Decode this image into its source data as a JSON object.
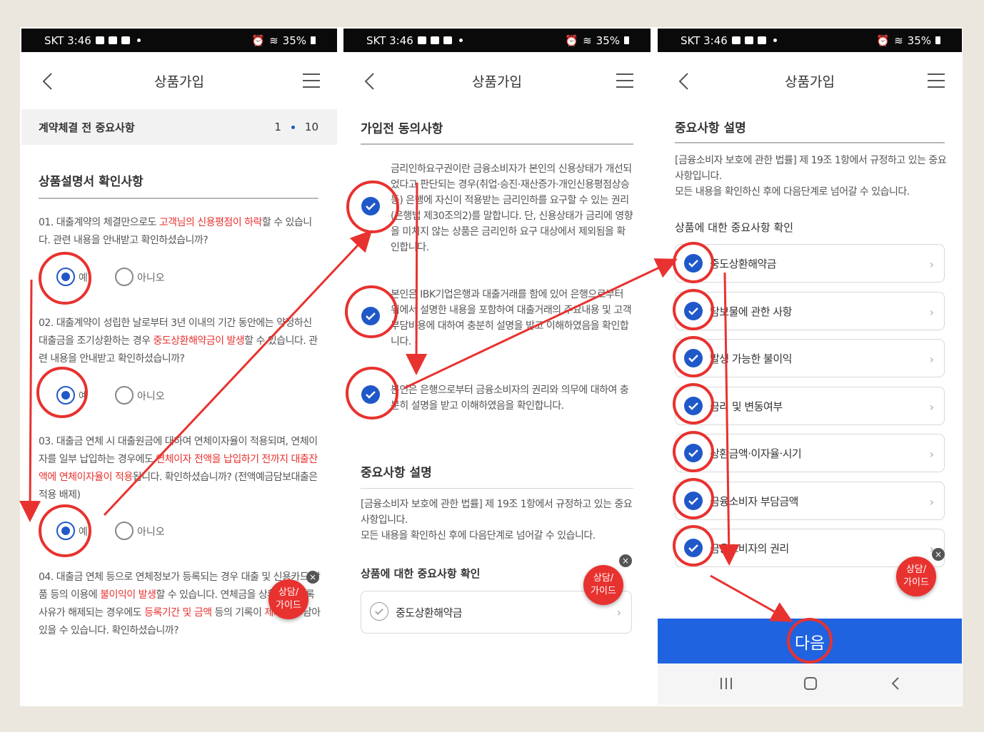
{
  "colors": {
    "accent_blue": "#1f58c8",
    "annotation_red": "#e8322f",
    "next_button": "#1f63e0"
  },
  "statusbar": {
    "carrier_time": "SKT 3:46",
    "battery": "35%"
  },
  "appbar": {
    "title": "상품가입"
  },
  "fab": {
    "line1": "상담/",
    "line2": "가이드",
    "close": "×"
  },
  "screen1": {
    "step_label": "계약체결 전 중요사항",
    "step_current": "1",
    "step_total": "10",
    "section_title": "상품설명서 확인사항",
    "yes": "예",
    "no": "아니오",
    "q1": {
      "a": "01. 대출계약의 체결만으로도 ",
      "red": "고객님의 신용평점이 하락",
      "b": "할 수 있습니다. 관련 내용을 안내받고 확인하셨습니까?"
    },
    "q2": {
      "a": "02. 대출계약이 성립한 날로부터 3년 이내의 기간 동안에는 약정하신 대출금을 조기상환하는 경우 ",
      "red": "중도상환해약금이 발생",
      "b": "할 수 있습니다. 관련 내용을 안내받고 확인하셨습니까?"
    },
    "q3": {
      "a": "03. 대출금 연체 시 대출원금에 대하여 연체이자율이 적용되며, 연체이자를 일부 납입하는 경우에도 ",
      "red": "연체이자 전액을 납입하기 전까지 대출잔액에 연체이자율이 적용",
      "b": "됩니다. 확인하셨습니까? (전액예금담보대출은 적용 배제)"
    },
    "q4": {
      "a": "04. 대출금 연체 등으로 연체정보가 등록되는 경우 대출 및 신용카드 상품 등의 이용에 ",
      "red1": "불이익이 발생",
      "b": "할 수 있습니다. 연체금을 상환하여 등록사유가 해제되는 경우에도 ",
      "red2": "등록기간 및 금액",
      "c": " 등의 기록이 ",
      "red3": "제기록",
      "d": "이 남아있을 수 있습니다. 확인하셨습니까?"
    }
  },
  "screen2": {
    "section_title": "가입전 동의사항",
    "consent1": "금리인하요구권이란 금융소비자가 본인의 신용상태가 개선되었다고 판단되는 경우(취업·승진·재산증가·개인신용평점상승 등) 은행에 자신이 적용받는 금리인하를 요구할 수 있는 권리(은행법 제30조의2)를 말합니다. 단, 신용상태가 금리에 영향을 미치지 않는 상품은 금리인하 요구 대상에서 제외됨을 확인합니다.",
    "consent2": "본인은 IBK기업은행과 대출거래를 함에 있어 은행으로부터 위에서 설명한 내용을 포함하여 대출거래의 주요내용 및 고객부담비용에 대하여 충분히 설명을 받고 이해하였음을 확인합니다.",
    "consent3": "본인은 은행으로부터 금융소비자의 권리와 의무에 대하여 충분히 설명을 받고 이해하였음을 확인합니다.",
    "important_title": "중요사항 설명",
    "important_body1": "[금융소비자 보호에 관한 법률] 제 19조 1항에서 규정하고 있는 중요사항입니다.",
    "important_body2": "모든 내용을 확인하신 후에 다음단계로 넘어갈 수 있습니다.",
    "product_check_title": "상품에 대한 중요사항 확인",
    "item1": "중도상환해약금"
  },
  "screen3": {
    "section_title": "중요사항 설명",
    "body1": "[금융소비자 보호에 관한 법률] 제 19조 1항에서 규정하고 있는 중요사항입니다.",
    "body2": "모든 내용을 확인하신 후에 다음단계로 넘어갈 수 있습니다.",
    "product_check_title": "상품에 대한 중요사항 확인",
    "items": [
      "중도상환해약금",
      "담보물에 관한 사항",
      "발생 가능한 불이익",
      "금리 및 변동여부",
      "상환금액·이자율·시기",
      "금융소비자 부담금액",
      "금융소비자의 권리"
    ],
    "next_label": "다음"
  }
}
